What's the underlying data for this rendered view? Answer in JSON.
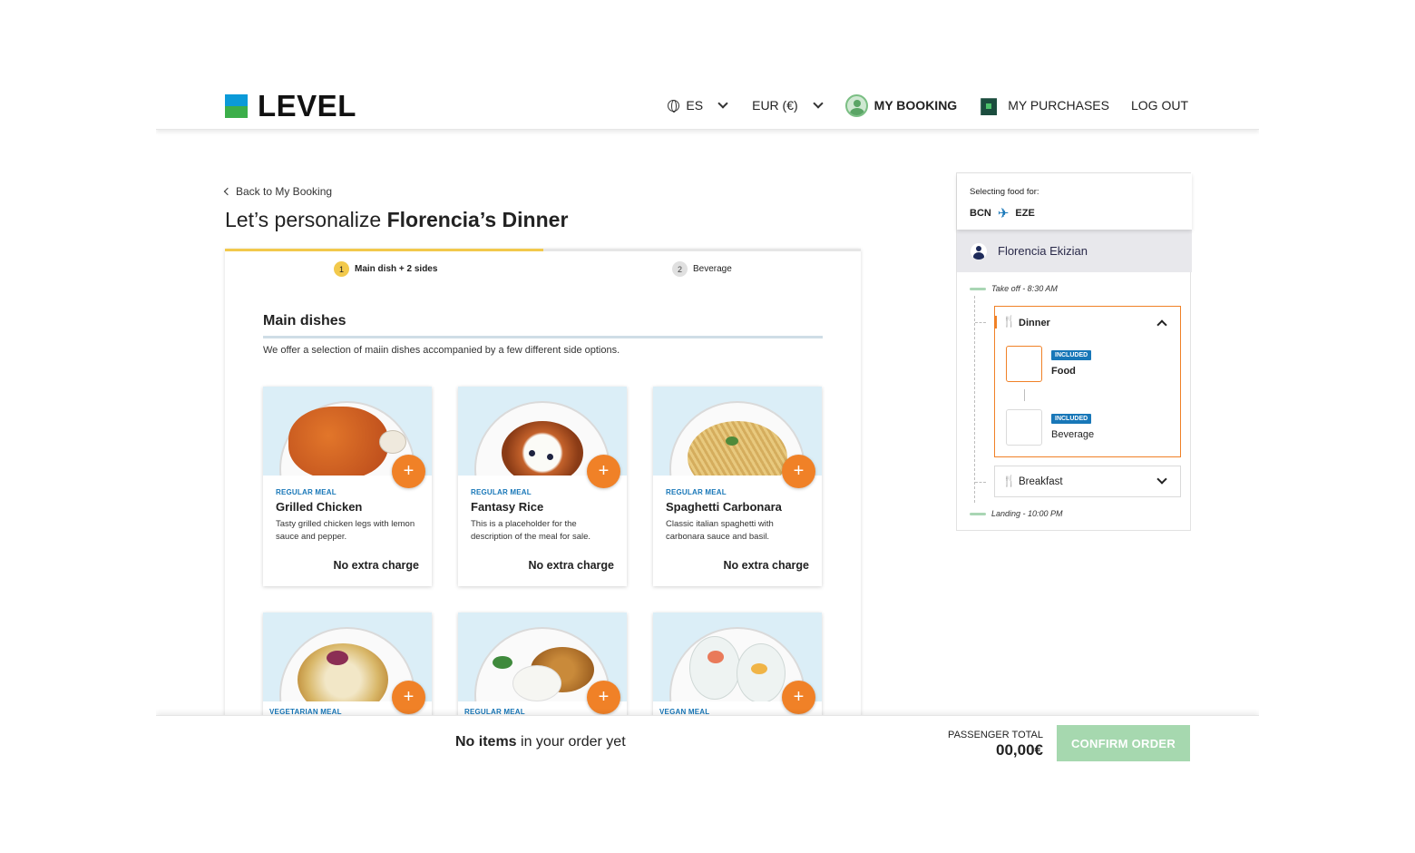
{
  "header": {
    "brand": "LEVEL",
    "language": "ES",
    "currency": "EUR (€)",
    "my_booking": "MY BOOKING",
    "my_purchases": "MY PURCHASES",
    "logout": "LOG OUT"
  },
  "page": {
    "back_link": "Back to My Booking",
    "title_prefix": "Let’s personalize ",
    "title_bold": "Florencia’s Dinner"
  },
  "steps": [
    {
      "number": "1",
      "label": "Main dish + 2 sides",
      "active": true
    },
    {
      "number": "2",
      "label": "Beverage",
      "active": false
    }
  ],
  "section": {
    "title": "Main dishes",
    "description": "We offer a selection of maiin dishes accompanied by a few different side options."
  },
  "meals": [
    {
      "tag": "REGULAR MEAL",
      "name": "Grilled Chicken",
      "description": "Tasty grilled chicken legs with lemon sauce and pepper.",
      "price": "No extra charge"
    },
    {
      "tag": "REGULAR MEAL",
      "name": "Fantasy Rice",
      "description": "This is a placeholder for the description of the meal for sale.",
      "price": "No extra charge"
    },
    {
      "tag": "REGULAR MEAL",
      "name": "Spaghetti Carbonara",
      "description": "Classic italian spaghetti with carbonara sauce and basil.",
      "price": "No extra charge"
    },
    {
      "tag": "VEGETARIAN MEAL"
    },
    {
      "tag": "REGULAR MEAL"
    },
    {
      "tag": "VEGAN MEAL"
    }
  ],
  "add_button": "+",
  "panel": {
    "label": "Selecting food for:",
    "origin": "BCN",
    "destination": "EZE",
    "passenger": "Florencia Ekizian",
    "takeoff": "Take off - 8:30 AM",
    "landing": "Landing - 10:00 PM",
    "dinner": {
      "title": "Dinner",
      "items": [
        {
          "badge": "INCLUDED",
          "label": "Food"
        },
        {
          "badge": "INCLUDED",
          "label": "Beverage"
        }
      ]
    },
    "breakfast": {
      "title": "Breakfast"
    }
  },
  "footer": {
    "no_items_bold": "No items",
    "no_items_rest": " in your order yet",
    "total_label": "PASSENGER TOTAL",
    "total_value": "00,00€",
    "confirm": "CONFIRM ORDER"
  },
  "colors": {
    "accent_orange": "#f08127",
    "brand_blue": "#0b9ad8",
    "brand_green": "#3cae4a",
    "step_yellow": "#f2c94c",
    "tag_blue": "#1877b8",
    "confirm_disabled": "#a6d8af"
  },
  "icons": {
    "language": "globe-icon",
    "account": "user-avatar-icon",
    "purchases": "shopping-bag-icon",
    "route": "airplane-icon",
    "meal_slot": "cutlery-icon"
  }
}
